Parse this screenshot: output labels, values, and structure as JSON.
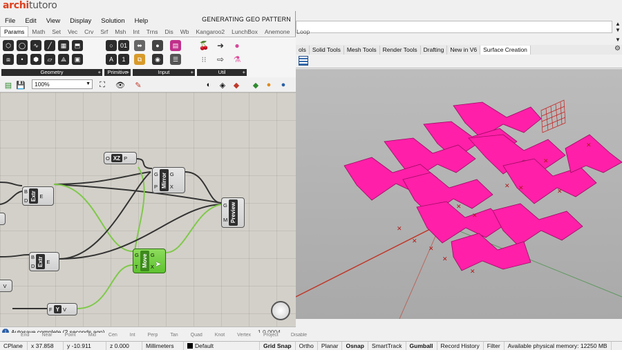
{
  "brand": {
    "part1": "archi",
    "part2": "tutoro"
  },
  "grasshopper": {
    "window_title": "GENERATING GEO PATTERN",
    "menu": [
      "File",
      "Edit",
      "View",
      "Display",
      "Solution",
      "Help"
    ],
    "tabs": [
      "Params",
      "Math",
      "Set",
      "Vec",
      "Crv",
      "Srf",
      "Msh",
      "Int",
      "Trns",
      "Dis",
      "Wb",
      "Kangaroo2",
      "LunchBox",
      "Anemone",
      "Loop"
    ],
    "active_tab": "Params",
    "ribbon_groups": [
      {
        "label": "Geometry",
        "icon_count": 12
      },
      {
        "label": "Primitive",
        "icon_count": 4
      },
      {
        "label": "Input",
        "icon_count": 6
      },
      {
        "label": "Util",
        "icon_count": 4
      }
    ],
    "zoom_value": "100%",
    "components": {
      "xz": {
        "title": "XZ",
        "inputs": [
          "O"
        ],
        "outputs": [
          "P"
        ]
      },
      "extr1": {
        "title": "Extr",
        "inputs": [
          "B",
          "D"
        ],
        "outputs": [
          "E"
        ]
      },
      "mirror": {
        "title": "Mirror",
        "inputs": [
          "G",
          "P"
        ],
        "outputs": [
          "G",
          "X"
        ]
      },
      "preview": {
        "title": "Preview",
        "inputs": [
          "G",
          "M"
        ],
        "outputs": []
      },
      "extr2": {
        "title": "Extr",
        "inputs": [
          "B",
          "D"
        ],
        "outputs": [
          "E"
        ]
      },
      "move": {
        "title": "Move",
        "inputs": [
          "G",
          "T"
        ],
        "outputs": [
          "G",
          "X"
        ]
      },
      "y": {
        "title": "Y",
        "inputs": [
          "F"
        ],
        "outputs": [
          "V"
        ]
      },
      "v_param": {
        "title": "V"
      }
    },
    "status_message": "Autosave complete (2 seconds ago)",
    "version": "1.0.0004"
  },
  "rhino": {
    "toolbar_tabs": [
      "ols",
      "Solid Tools",
      "Mesh Tools",
      "Render Tools",
      "Drafting",
      "New in V6",
      "Surface Creation"
    ],
    "active_toolbar_tab": "Surface Creation",
    "osnap_items": [
      "End",
      "Near",
      "Point",
      "Mid",
      "Cen",
      "Int",
      "Perp",
      "Tan",
      "Quad",
      "Knot",
      "Vertex",
      "Project",
      "Disable"
    ],
    "statusbar": {
      "cplane": "CPlane",
      "x": "x 37.858",
      "y": "y -10.911",
      "z": "z 0.000",
      "units": "Millimeters",
      "layer": "Default",
      "toggles": [
        "Grid Snap",
        "Ortho",
        "Planar",
        "Osnap",
        "SmartTrack",
        "Gumball",
        "Record History",
        "Filter"
      ],
      "bold_toggles": [
        "Grid Snap",
        "Osnap",
        "Gumball"
      ],
      "memory": "Available physical memory: 12250 MB"
    }
  },
  "colors": {
    "pink": "#ff1fa8",
    "wire_green": "#7fc94a",
    "brand": "#e0401f"
  }
}
